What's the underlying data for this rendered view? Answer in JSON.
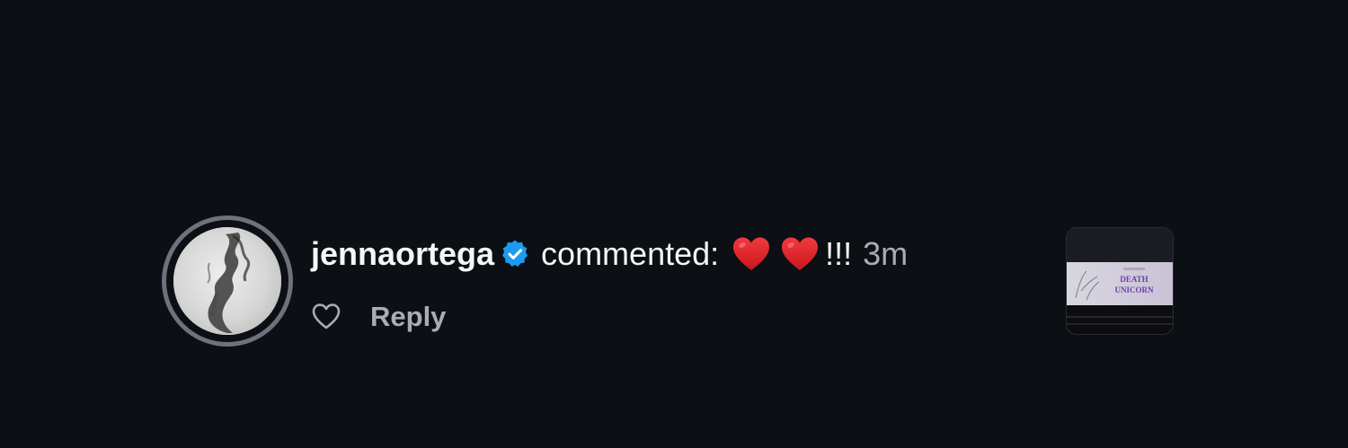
{
  "notification": {
    "username": "jennaortega",
    "verified": true,
    "action": "commented:",
    "comment_text": "!!!",
    "emojis": [
      "red-heart",
      "red-heart"
    ],
    "timestamp": "3m",
    "reply_label": "Reply",
    "thumbnail": {
      "poster_title_line1": "DEATH",
      "poster_title_line2": "UNICORN"
    }
  },
  "colors": {
    "background": "#0c0f14",
    "primary_text": "#f5f5f5",
    "secondary_text": "#a8adb5",
    "verified_badge": "#1d9bf0",
    "heart": "#e0282e",
    "story_ring": "#6d727c"
  },
  "icons": {
    "verified": "verified-badge-icon",
    "like": "heart-outline-icon",
    "emoji": "red-heart-emoji"
  }
}
